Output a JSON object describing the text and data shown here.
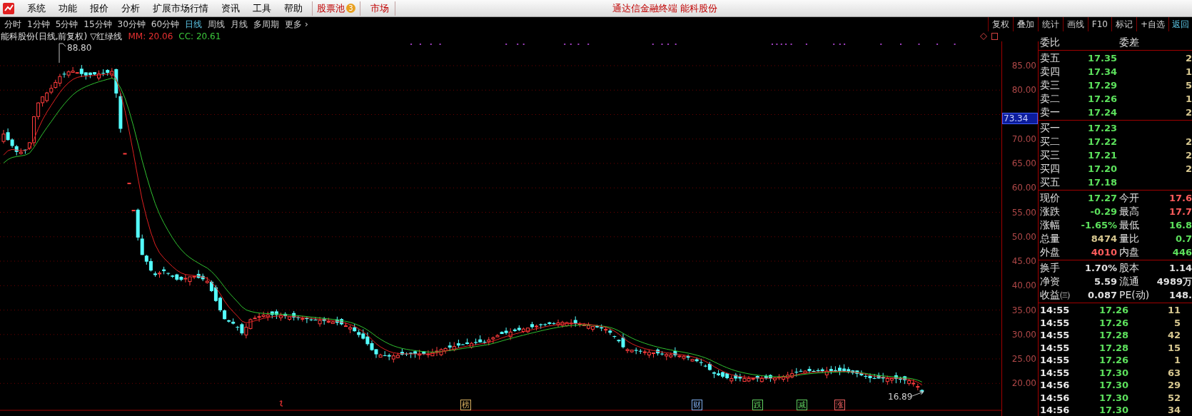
{
  "menu_bar": {
    "items": [
      {
        "label": "系统"
      },
      {
        "label": "功能"
      },
      {
        "label": "报价"
      },
      {
        "label": "分析"
      },
      {
        "label": "扩展市场行情"
      },
      {
        "label": "资讯"
      },
      {
        "label": "工具"
      },
      {
        "label": "帮助"
      }
    ],
    "stock_pool": {
      "label": "股票池",
      "badge": "3"
    },
    "market": {
      "label": "市场"
    },
    "title": "通达信金融终端 能科股份"
  },
  "period_tabs": [
    {
      "label": "分时",
      "selected": false
    },
    {
      "label": "1分钟",
      "selected": false
    },
    {
      "label": "5分钟",
      "selected": false
    },
    {
      "label": "15分钟",
      "selected": false
    },
    {
      "label": "30分钟",
      "selected": false
    },
    {
      "label": "60分钟",
      "selected": false
    },
    {
      "label": "日线",
      "selected": true
    },
    {
      "label": "周线",
      "selected": false
    },
    {
      "label": "月线",
      "selected": false
    },
    {
      "label": "多周期",
      "selected": false
    },
    {
      "label": "更多 ›",
      "selected": false
    }
  ],
  "toolbar": [
    {
      "label": "复权",
      "kind": "box"
    },
    {
      "label": "叠加",
      "kind": "box"
    },
    {
      "label": "统计",
      "kind": "box"
    },
    {
      "label": "画线",
      "kind": "box"
    },
    {
      "label": "F10",
      "kind": "box"
    },
    {
      "label": "标记",
      "kind": "box"
    },
    {
      "label": "+自选",
      "kind": "box"
    },
    {
      "label": "返回",
      "kind": "link"
    }
  ],
  "chart": {
    "title": "能科股份(日线,前复权)",
    "indicator": "▽红绿线",
    "indicator_values": [
      {
        "text": "MM: 20.06",
        "color": "#e83030"
      },
      {
        "text": "CC: 20.61",
        "color": "#3cc83c"
      }
    ],
    "high_label": "88.80",
    "low_label": "16.89",
    "price_axis": [
      {
        "label": "85.00",
        "kind": "tick"
      },
      {
        "label": "80.00",
        "kind": "tick"
      },
      {
        "label": "73.34",
        "kind": "cursor"
      },
      {
        "label": "70.00",
        "kind": "tick"
      },
      {
        "label": "65.00",
        "kind": "tick"
      },
      {
        "label": "60.00",
        "kind": "tick"
      },
      {
        "label": "55.00",
        "kind": "tick"
      },
      {
        "label": "50.00",
        "kind": "tick"
      },
      {
        "label": "45.00",
        "kind": "tick"
      },
      {
        "label": "40.00",
        "kind": "tick"
      },
      {
        "label": "35.00",
        "kind": "tick"
      },
      {
        "label": "30.00",
        "kind": "tick"
      },
      {
        "label": "25.00",
        "kind": "tick"
      },
      {
        "label": "20.00",
        "kind": "tick"
      }
    ],
    "event_markers": [
      {
        "label": "榜",
        "color": "#d8b060"
      },
      {
        "label": "财",
        "color": "#80b0f0"
      },
      {
        "label": "跌",
        "color": "#60d060"
      },
      {
        "label": "减",
        "color": "#60d060"
      },
      {
        "label": "涨",
        "color": "#f06060"
      }
    ]
  },
  "order_book": {
    "header": {
      "label": "委比",
      "label2": "委差"
    },
    "asks": [
      {
        "label": "卖五",
        "price": "17.35",
        "volume": "2"
      },
      {
        "label": "卖四",
        "price": "17.34",
        "volume": "1"
      },
      {
        "label": "卖三",
        "price": "17.29",
        "volume": "5"
      },
      {
        "label": "卖二",
        "price": "17.26",
        "volume": "1"
      },
      {
        "label": "卖一",
        "price": "17.24",
        "volume": "2"
      }
    ],
    "bids": [
      {
        "label": "买一",
        "price": "17.23"
      },
      {
        "label": "买二",
        "price": "17.22",
        "volume": "2"
      },
      {
        "label": "买三",
        "price": "17.21",
        "volume": "2"
      },
      {
        "label": "买四",
        "price": "17.20",
        "volume": "2"
      },
      {
        "label": "买五",
        "price": "17.18"
      }
    ]
  },
  "quote": [
    {
      "cells": [
        {
          "label": "现价",
          "value": "17.27",
          "color": "#5ce05c"
        },
        {
          "label": "今开",
          "value": "17.6",
          "color": "#ff5c5c"
        }
      ]
    },
    {
      "cells": [
        {
          "label": "涨跌",
          "value": "-0.29",
          "color": "#5ce05c"
        },
        {
          "label": "最高",
          "value": "17.7",
          "color": "#ff5c5c"
        }
      ]
    },
    {
      "cells": [
        {
          "label": "涨幅",
          "value": "-1.65%",
          "color": "#5ce05c"
        },
        {
          "label": "最低",
          "value": "16.8",
          "color": "#5ce05c"
        }
      ]
    },
    {
      "cells": [
        {
          "label": "总量",
          "value": "8474",
          "color": "#d8c890"
        },
        {
          "label": "量比",
          "value": "0.7",
          "color": "#5ce05c"
        }
      ]
    },
    {
      "cells": [
        {
          "label": "外盘",
          "value": "4010",
          "color": "#ff5c5c"
        },
        {
          "label": "内盘",
          "value": "446",
          "color": "#5ce05c"
        }
      ]
    }
  ],
  "fundamentals": [
    {
      "label": "换手",
      "value": "1.70%",
      "label2": "股本",
      "value2": "1.14"
    },
    {
      "label": "净资",
      "value": "5.59",
      "label2": "流通",
      "value2": "4989万"
    },
    {
      "label": "收益㈢",
      "value": "0.087",
      "label2": "PE(动)",
      "value2": "148."
    }
  ],
  "ticks": [
    {
      "time": "14:55",
      "price": "17.26",
      "volume": "11"
    },
    {
      "time": "14:55",
      "price": "17.26",
      "volume": "5"
    },
    {
      "time": "14:55",
      "price": "17.28",
      "volume": "42"
    },
    {
      "time": "14:55",
      "price": "17.28",
      "volume": "15"
    },
    {
      "time": "14:55",
      "price": "17.26",
      "volume": "1"
    },
    {
      "time": "14:55",
      "price": "17.30",
      "volume": "63"
    },
    {
      "time": "14:56",
      "price": "17.30",
      "volume": "29"
    },
    {
      "time": "14:56",
      "price": "17.30",
      "volume": "52"
    },
    {
      "time": "14:56",
      "price": "17.30",
      "volume": "34"
    }
  ]
}
